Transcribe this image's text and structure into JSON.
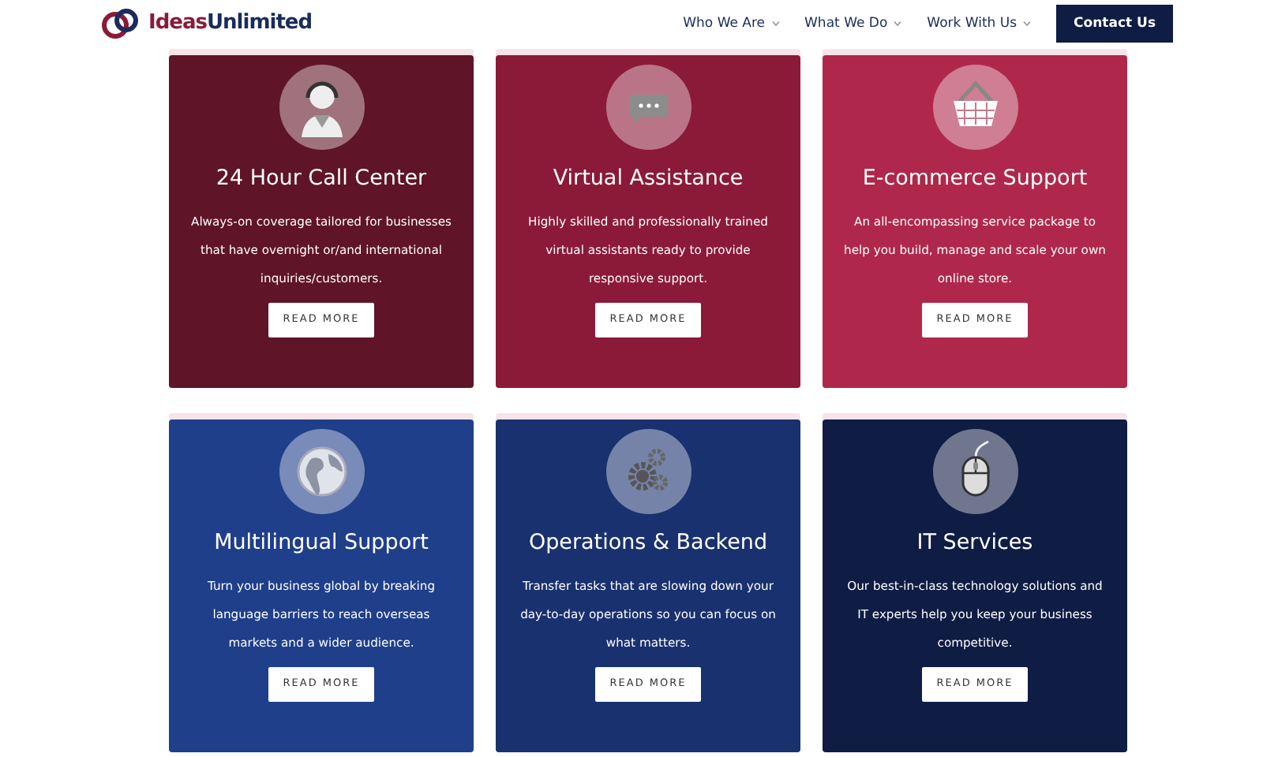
{
  "header": {
    "logo": {
      "part_1": "Ideas",
      "part_2": "Unlimited"
    },
    "nav": [
      {
        "label": "Who We Are",
        "has_dropdown": true
      },
      {
        "label": "What We Do",
        "has_dropdown": true
      },
      {
        "label": "Work With Us",
        "has_dropdown": true
      }
    ],
    "cta": "Contact Us"
  },
  "services": [
    {
      "kind": "agent",
      "color": "#5f1427",
      "title": "24 Hour Call Center",
      "text": "Always-on coverage tailored for businesses that have overnight or/and international inquiries/customers.",
      "button": "READ MORE"
    },
    {
      "kind": "chat",
      "color": "#8b1a38",
      "title": "Virtual Assistance",
      "text": "Highly skilled and professionally trained virtual assistants ready to provide responsive support.",
      "button": "READ MORE"
    },
    {
      "kind": "basket",
      "color": "#af284b",
      "title": "E-commerce Support",
      "text": "An all-encompassing service package to help you build, manage and scale your own online store.",
      "button": "READ MORE"
    },
    {
      "kind": "globe",
      "color": "#1f3f8a",
      "title": "Multilingual Support",
      "text": "Turn your business global by breaking language barriers to reach overseas markets and a wider audience.",
      "button": "READ MORE"
    },
    {
      "kind": "gears",
      "color": "#19316e",
      "title": "Operations & Backend",
      "text": "Transfer tasks that are slowing down your day-to-day operations so you can focus on what matters.",
      "button": "READ MORE"
    },
    {
      "kind": "mouse",
      "color": "#0f1c44",
      "title": "IT Services",
      "text": "Our best-in-class technology solutions and IT experts help you keep your business competitive.",
      "button": "READ MORE"
    }
  ]
}
